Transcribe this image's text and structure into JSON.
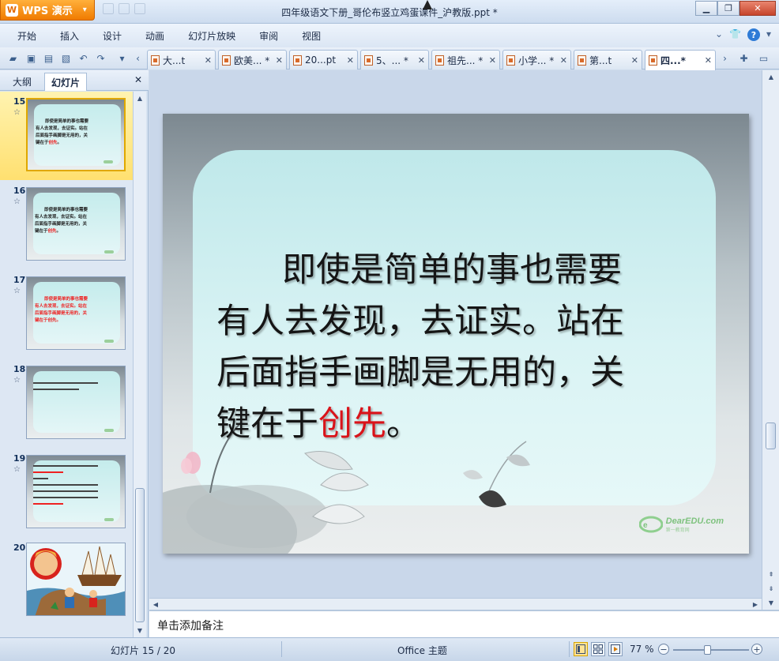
{
  "app": {
    "name": "WPS 演示",
    "logo": "W"
  },
  "window": {
    "title": "四年级语文下册_哥伦布竖立鸡蛋课件_沪教版.ppt *"
  },
  "menu": [
    "开始",
    "插入",
    "设计",
    "动画",
    "幻灯片放映",
    "审阅",
    "视图"
  ],
  "doc_tabs": [
    "大...t",
    "欧美... *",
    "20...pt",
    "5、... *",
    "祖先... *",
    "小学... *",
    "第...t",
    "四...*"
  ],
  "panel": {
    "tab_outline": "大纲",
    "tab_slides": "幻灯片"
  },
  "thumbnails": [
    {
      "num": "15",
      "lines": [
        "即使是简单的事也需要",
        "有人去发现，去证实。站在",
        "后面指手画脚是无用的，关",
        "键在于"
      ],
      "emphasis": "创先",
      "tail": "。"
    },
    {
      "num": "16",
      "lines": [
        "即使是简单的事也需要",
        "有人去发现，去证实。站在",
        "后面指手画脚是无用的，关",
        "键在于"
      ],
      "emphasis": "创先",
      "tail": "。"
    },
    {
      "num": "17",
      "lines": [
        "即使是简单的事也需要",
        "有人去发现，去证实。站在",
        "后面指手画脚是无用的，关",
        "键在于创先。"
      ]
    },
    {
      "num": "18"
    },
    {
      "num": "19"
    },
    {
      "num": "20"
    }
  ],
  "slide": {
    "line1": "即使是简单的事也需要",
    "line2": "有人去发现，去证实。站在",
    "line3": "后面指手画脚是无用的，关",
    "line4_pre": "键在于",
    "line4_em": "创先",
    "line4_post": "。",
    "watermark": "DearEDU.com",
    "watermark_sub": "第一教育网"
  },
  "notes_placeholder": "单击添加备注",
  "status": {
    "slide_info": "幻灯片 15 / 20",
    "theme": "Office 主题",
    "zoom": "77 %"
  },
  "zoom_level": 0.77,
  "colors": {
    "accent": "#f07b00",
    "emphasis": "#d9131a",
    "selection": "#ffe070"
  }
}
